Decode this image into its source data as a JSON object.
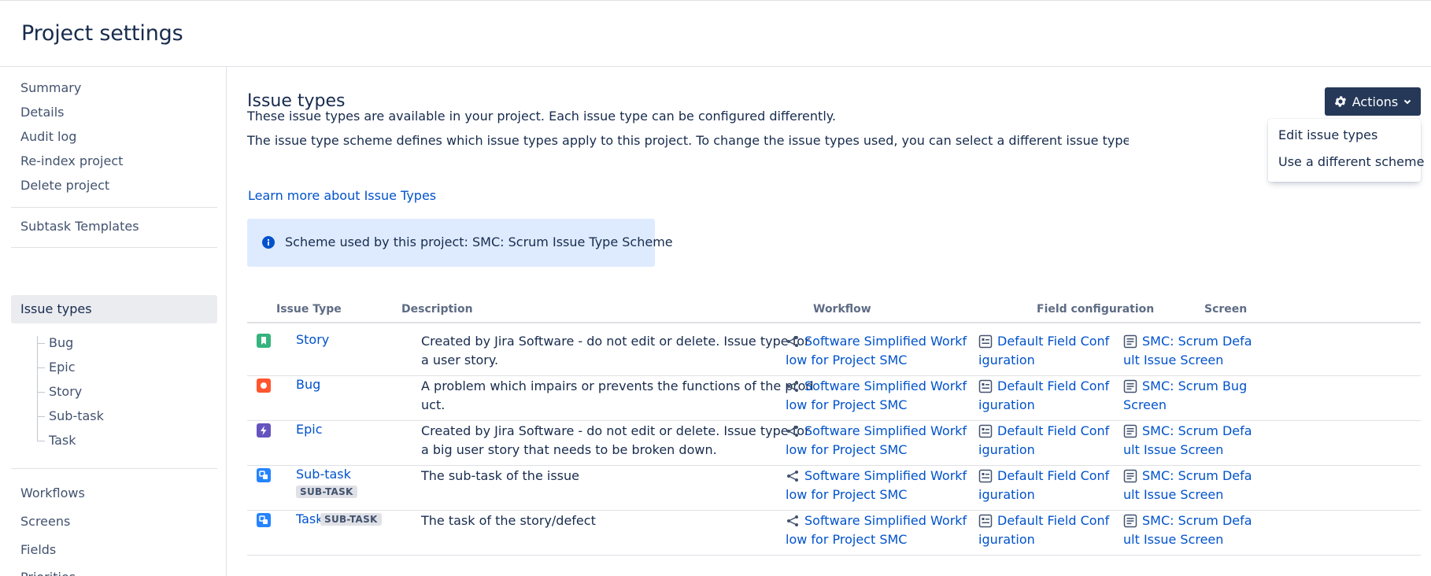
{
  "header": {
    "title": "Project settings"
  },
  "sidebar": {
    "items_top": [
      "Summary",
      "Details",
      "Audit log",
      "Re-index project",
      "Delete project"
    ],
    "subtask_templates": "Subtask Templates",
    "selected": "Issue types",
    "issue_type_children": [
      "Bug",
      "Epic",
      "Story",
      "Sub-task",
      "Task"
    ],
    "items_bottom": [
      "Workflows",
      "Screens",
      "Fields",
      "Priorities"
    ]
  },
  "main": {
    "title": "Issue types",
    "actions_label": "Actions",
    "para1": "These issue types are available in your project. Each issue type can be configured differently.",
    "para2": "The issue type scheme defines which issue types apply to this project. To change the issue types used, you can select a different issue type scheme, or modify the current scheme.",
    "learn_more": "Learn more about Issue Types",
    "info": "Scheme used by this project: SMC: Scrum Issue Type Scheme",
    "dropdown": [
      "Edit issue types",
      "Use a different scheme"
    ]
  },
  "table": {
    "headers": [
      "Issue Type",
      "Description",
      "Workflow",
      "Field configuration",
      "Screen"
    ],
    "rows": [
      {
        "name": "Story",
        "icon": "story-icon",
        "color": "#36b37e",
        "badge": "",
        "description": "Created by Jira Software - do not edit or delete. Issue type for a user story.",
        "workflow": "Software Simplified Workflow for Project SMC",
        "field_config": "Default Field Configuration",
        "screen": "SMC: Scrum Default Issue Screen"
      },
      {
        "name": "Bug",
        "icon": "bug-icon",
        "color": "#ff5630",
        "badge": "",
        "description": "A problem which impairs or prevents the functions of the product.",
        "workflow": "Software Simplified Workflow for Project SMC",
        "field_config": "Default Field Configuration",
        "screen": "SMC: Scrum Bug Screen"
      },
      {
        "name": "Epic",
        "icon": "epic-icon",
        "color": "#6554c0",
        "badge": "",
        "description": "Created by Jira Software - do not edit or delete. Issue type for a big user story that needs to be broken down.",
        "workflow": "Software Simplified Workflow for Project SMC",
        "field_config": "Default Field Configuration",
        "screen": "SMC: Scrum Default Issue Screen"
      },
      {
        "name": "Sub-task",
        "icon": "subtask-icon",
        "color": "#2684ff",
        "badge": "SUB-TASK",
        "description": "The sub-task of the issue",
        "workflow": "Software Simplified Workflow for Project SMC",
        "field_config": "Default Field Configuration",
        "screen": "SMC: Scrum Default Issue Screen"
      },
      {
        "name": "Task",
        "icon": "task-icon",
        "color": "#2684ff",
        "badge": "SUB-TASK",
        "description": "The task of the story/defect",
        "workflow": "Software Simplified Workflow for Project SMC",
        "field_config": "Default Field Configuration",
        "screen": "SMC: Scrum Default Issue Screen"
      }
    ]
  },
  "colors": {
    "accent": "#0052cc",
    "actions_bg": "#253858",
    "info_bg": "#deebff"
  }
}
